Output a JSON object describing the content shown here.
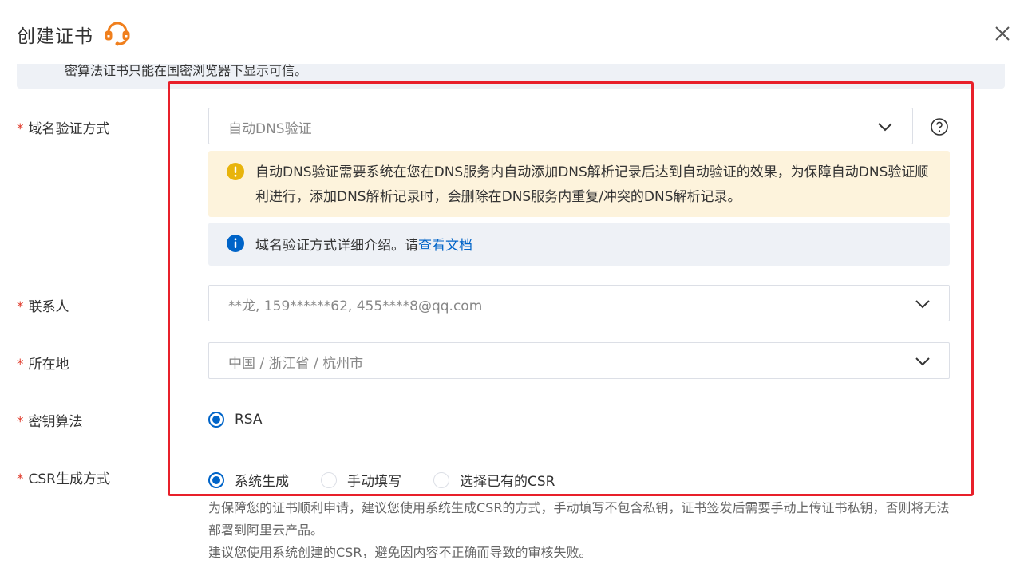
{
  "dialog": {
    "title": "创建证书",
    "top_notice": "密算法证书只能在国密浏览器下显示可信。"
  },
  "form": {
    "domain_verify": {
      "label": "域名验证方式",
      "value": "自动DNS验证",
      "warning": "自动DNS验证需要系统在您在DNS服务内自动添加DNS解析记录后达到自动验证的效果，为保障自动DNS验证顺利进行，添加DNS解析记录时，会删除在DNS服务内重复/冲突的DNS解析记录。",
      "info_text": "域名验证方式详细介绍。请",
      "info_link": "查看文档"
    },
    "contact": {
      "label": "联系人",
      "value": "**龙, 159******62, 455****8@qq.com"
    },
    "location": {
      "label": "所在地",
      "value": "中国 / 浙江省 / 杭州市"
    },
    "key_algorithm": {
      "label": "密钥算法",
      "options": [
        {
          "label": "RSA",
          "selected": true
        }
      ]
    },
    "csr": {
      "label": "CSR生成方式",
      "options": [
        {
          "label": "系统生成",
          "selected": true
        },
        {
          "label": "手动填写",
          "selected": false
        },
        {
          "label": "选择已有的CSR",
          "selected": false
        }
      ],
      "hint_line1": "为保障您的证书顺利申请，建议您使用系统生成CSR的方式，手动填写不包含私钥，证书签发后需要手动上传证书私钥，否则将无法部署到阿里云产品。",
      "hint_line2": "建议您使用系统创建的CSR，避免因内容不正确而导致的审核失败。"
    },
    "required_mark": "*"
  },
  "colors": {
    "accent": "#0064c8",
    "required": "#e03c2d",
    "highlight_box": "#e8202a",
    "warning_bg": "#fdf3dc",
    "info_bg": "#eef1f6",
    "warning_icon": "#e8b40c",
    "support_icon": "#f07f1d"
  },
  "icons": {
    "support": "headset-icon",
    "close": "close-icon",
    "help": "question-circle-icon",
    "warning": "warning-circle-icon",
    "info": "info-circle-icon",
    "dropdown": "chevron-down-icon"
  }
}
